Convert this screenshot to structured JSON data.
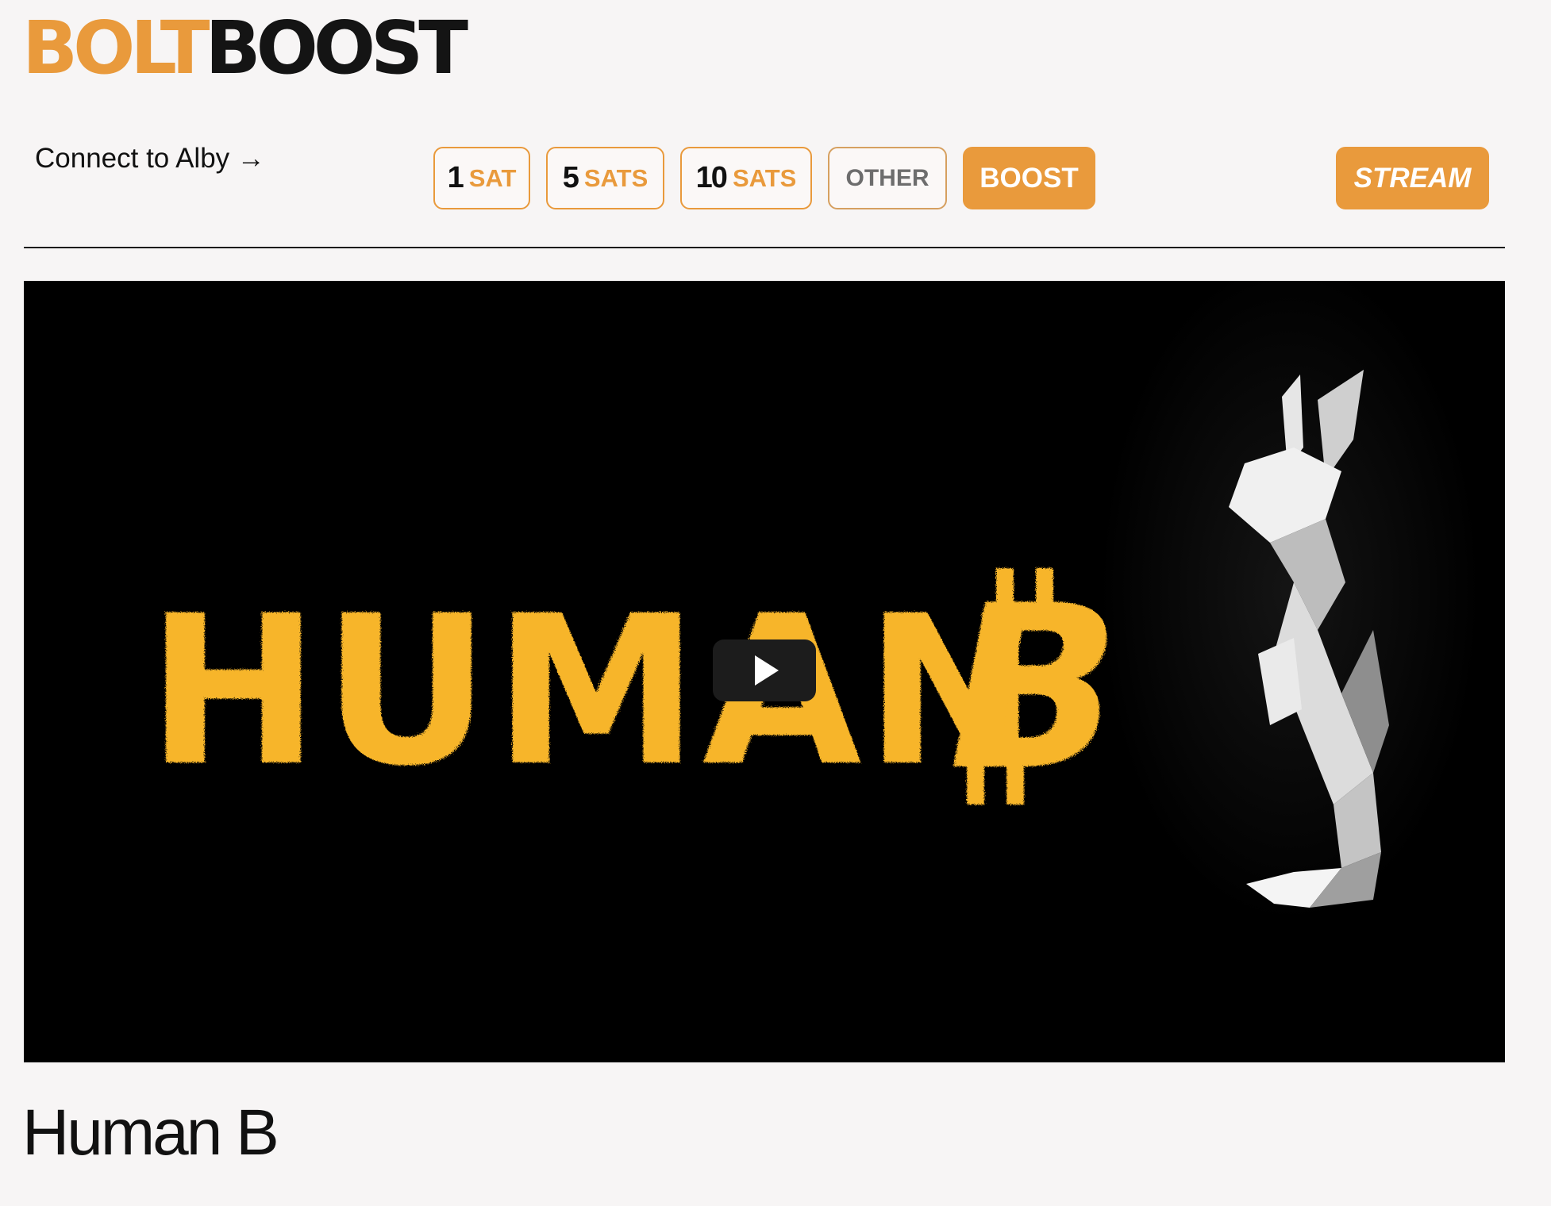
{
  "logo": {
    "part1": "BOLT",
    "part2": "BOOST"
  },
  "header": {
    "connect_label": "Connect to Alby →"
  },
  "amounts": [
    {
      "num": "1",
      "unit": "SAT"
    },
    {
      "num": "5",
      "unit": "SATS"
    },
    {
      "num": "10",
      "unit": "SATS"
    }
  ],
  "actions": {
    "other_label": "OTHER",
    "boost_label": "BOOST",
    "stream_label": "STREAM"
  },
  "video": {
    "thumbnail_text": "HUMAN",
    "thumbnail_symbol": "B",
    "play_icon": "play-icon"
  },
  "colors": {
    "accent": "#e99a3c",
    "thumbnail_text": "#f7b52a",
    "background": "#f7f5f5"
  },
  "content": {
    "title": "Human B"
  }
}
